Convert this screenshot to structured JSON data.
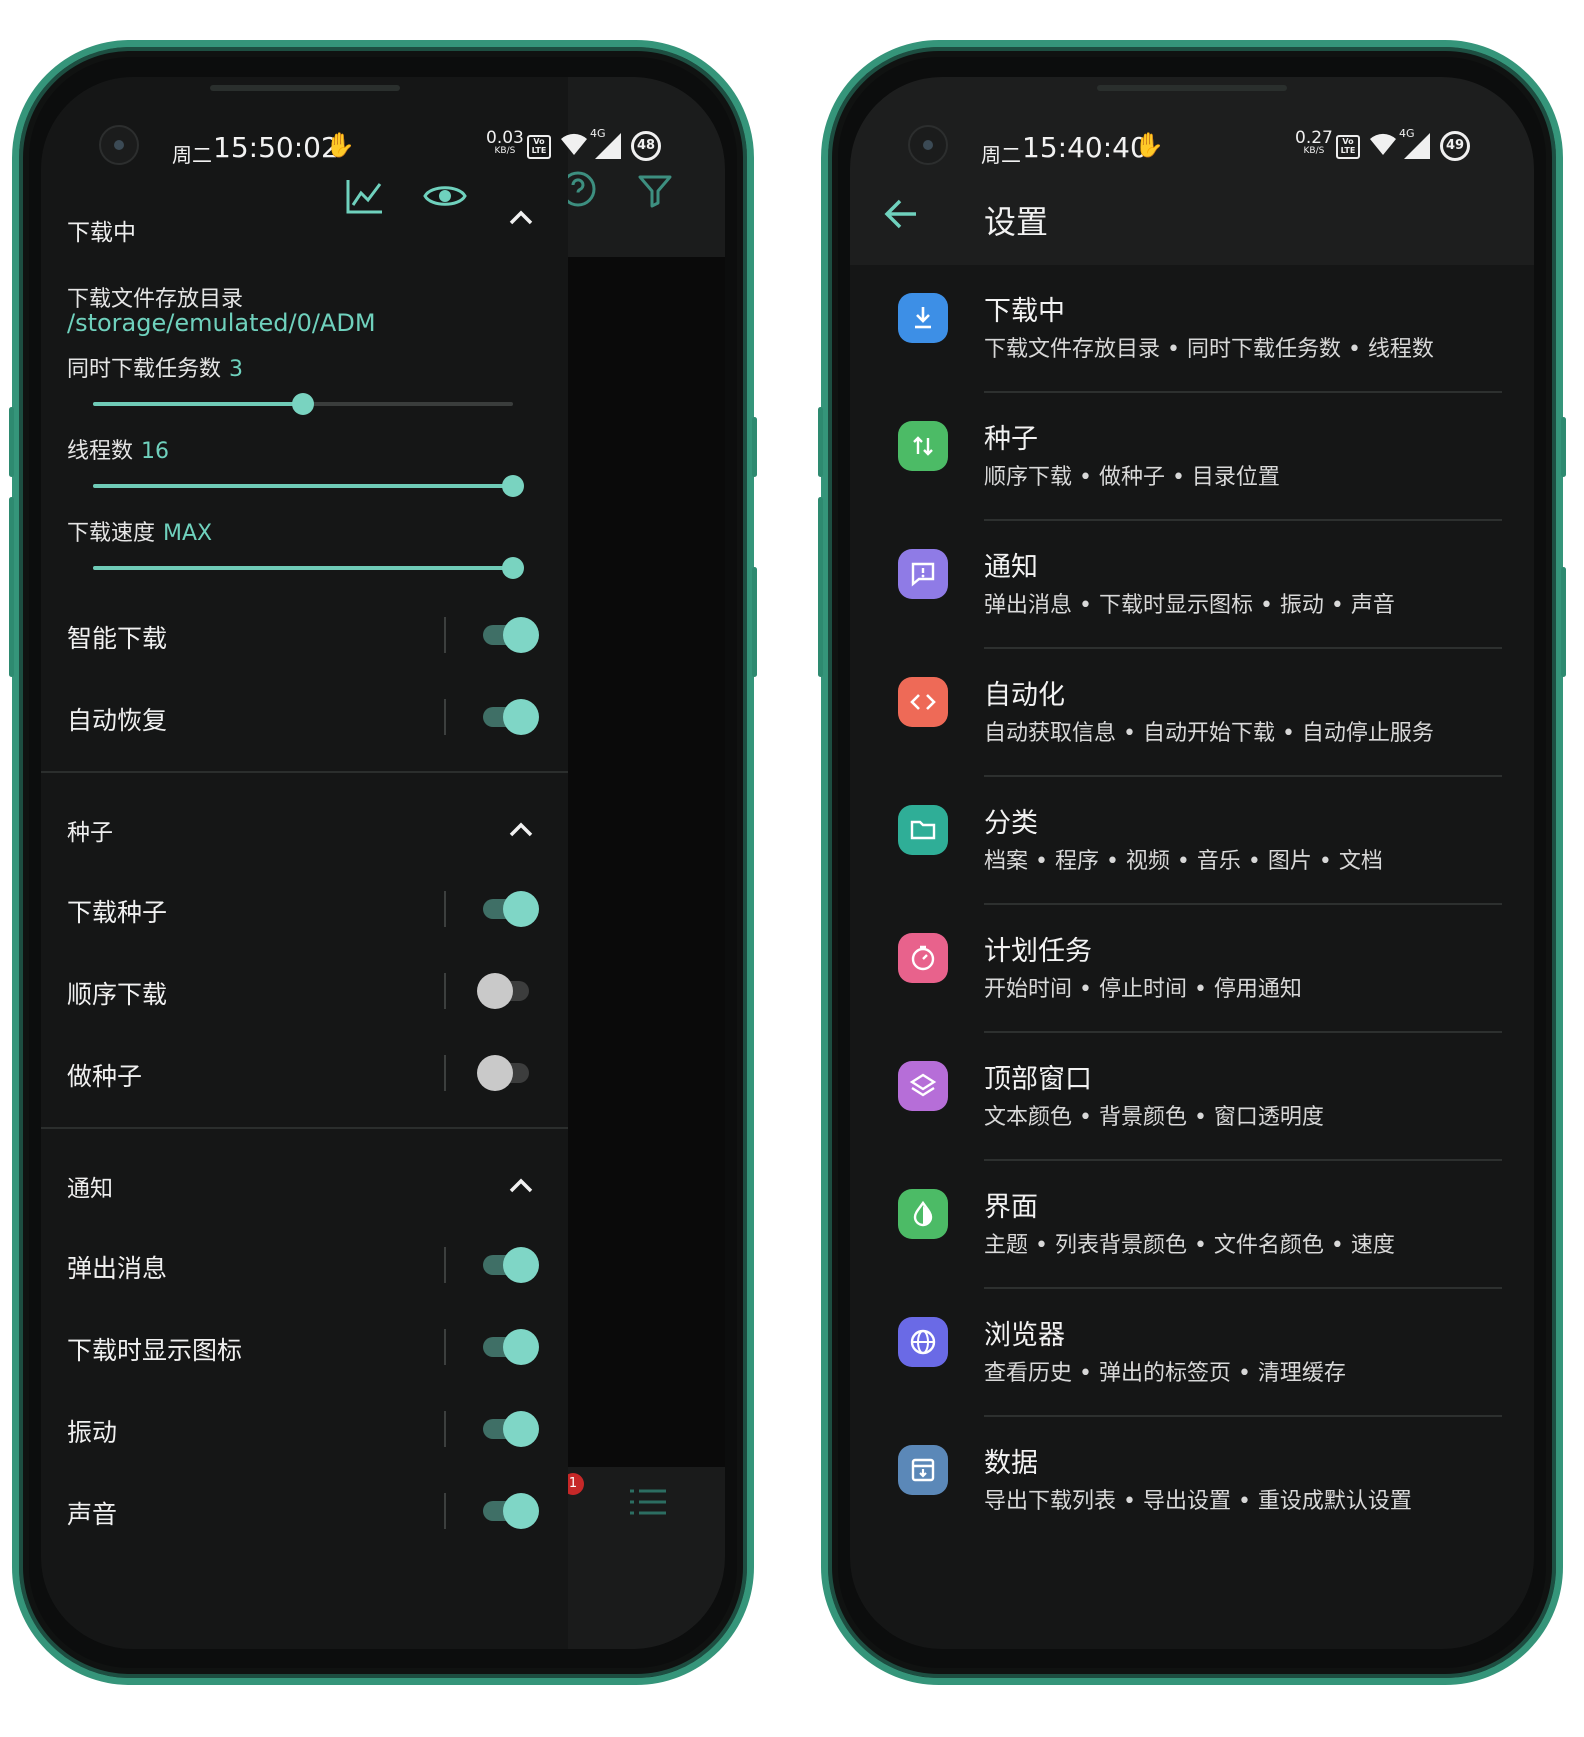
{
  "colors": {
    "accent": "#6fd1bd",
    "frame": "#35957a",
    "background": "#151616"
  },
  "left": {
    "status": {
      "day": "周二",
      "time": "15:50:02",
      "speed": "0.03",
      "speed_unit": "KB/S",
      "volte": "Vo LTE",
      "network": "4G",
      "battery": "48"
    },
    "toolbar": {
      "icons": [
        "chart-icon",
        "eye-icon",
        "chevron-up-icon",
        "help-icon",
        "filter-icon"
      ]
    },
    "downloading": {
      "title": "下载中",
      "dir_label": "下载文件存放目录",
      "dir_value": "/storage/emulated/0/ADM",
      "tasks_label": "同时下载任务数",
      "tasks_value": "3",
      "tasks_level": 0.5,
      "threads_label": "线程数",
      "threads_value": "16",
      "threads_level": 1.0,
      "speed_label": "下载速度",
      "speed_value": "MAX",
      "speed_level": 1.0,
      "smart": "智能下载",
      "smart_on": true,
      "resume": "自动恢复",
      "resume_on": true
    },
    "torrent": {
      "title": "种子",
      "download": "下载种子",
      "download_on": true,
      "sequential": "顺序下载",
      "sequential_on": false,
      "seed": "做种子",
      "seed_on": false
    },
    "notify": {
      "title": "通知",
      "popup": "弹出消息",
      "popup_on": true,
      "show_icon": "下载时显示图标",
      "show_icon_on": true,
      "vibrate": "振动",
      "vibrate_on": true,
      "sound": "声音",
      "sound_on": true
    },
    "badge": "1"
  },
  "right": {
    "status": {
      "day": "周二",
      "time": "15:40:40",
      "speed": "0.27",
      "speed_unit": "KB/S",
      "volte": "Vo LTE",
      "network": "4G",
      "battery": "49"
    },
    "title": "设置",
    "items": [
      {
        "title": "下载中",
        "sub": "下载文件存放目录 • 同时下载任务数 • 线程数",
        "color": "#3d8fe6",
        "icon": "download-icon"
      },
      {
        "title": "种子",
        "sub": "顺序下载 • 做种子 • 目录位置",
        "color": "#4cbb66",
        "icon": "swap-vertical-icon"
      },
      {
        "title": "通知",
        "sub": "弹出消息 • 下载时显示图标 • 振动 • 声音",
        "color": "#8f7be6",
        "icon": "message-alert-icon"
      },
      {
        "title": "自动化",
        "sub": "自动获取信息 • 自动开始下载 • 自动停止服务",
        "color": "#ee6a57",
        "icon": "code-icon"
      },
      {
        "title": "分类",
        "sub": "档案 • 程序 • 视频 • 音乐 • 图片 • 文档",
        "color": "#2fae97",
        "icon": "folder-icon"
      },
      {
        "title": "计划任务",
        "sub": "开始时间 • 停止时间 • 停用通知",
        "color": "#e8628c",
        "icon": "timer-icon"
      },
      {
        "title": "顶部窗口",
        "sub": "文本颜色 • 背景颜色 • 窗口透明度",
        "color": "#b66ed8",
        "icon": "layers-icon"
      },
      {
        "title": "界面",
        "sub": "主题 • 列表背景颜色 • 文件名颜色 • 速度",
        "color": "#4cbb66",
        "icon": "contrast-drop-icon"
      },
      {
        "title": "浏览器",
        "sub": "查看历史 • 弹出的标签页 • 清理缓存",
        "color": "#6a6ae6",
        "icon": "globe-icon"
      },
      {
        "title": "数据",
        "sub": "导出下载列表 • 导出设置 • 重设成默认设置",
        "color": "#5b88b8",
        "icon": "archive-icon"
      }
    ]
  }
}
